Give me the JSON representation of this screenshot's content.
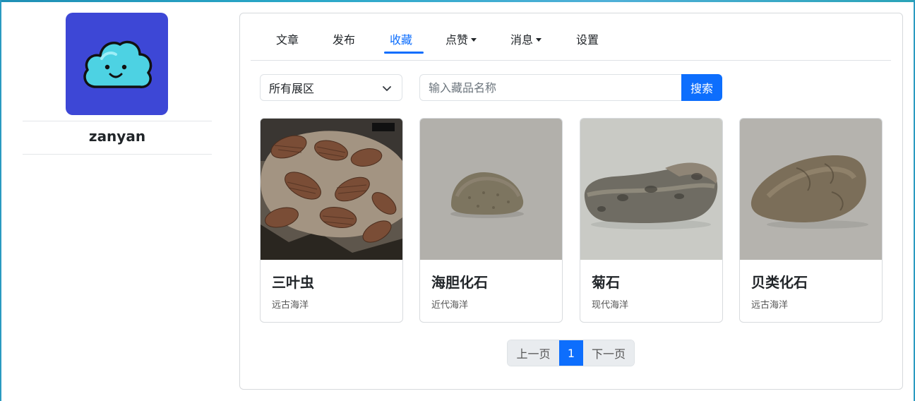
{
  "profile": {
    "username": "zanyan",
    "avatar_icon": "cloud-smile-icon"
  },
  "tabs": [
    {
      "label": "文章"
    },
    {
      "label": "发布"
    },
    {
      "label": "收藏",
      "active": true
    },
    {
      "label": "点赞",
      "dropdown": true
    },
    {
      "label": "消息",
      "dropdown": true
    },
    {
      "label": "设置"
    }
  ],
  "filter": {
    "selected": "所有展区"
  },
  "search": {
    "placeholder": "输入藏品名称",
    "button_label": "搜索"
  },
  "cards": [
    {
      "title": "三叶虫",
      "subtitle": "远古海洋"
    },
    {
      "title": "海胆化石",
      "subtitle": "近代海洋"
    },
    {
      "title": "菊石",
      "subtitle": "现代海洋"
    },
    {
      "title": "贝类化石",
      "subtitle": "远古海洋"
    }
  ],
  "pagination": {
    "prev": "上一页",
    "current": "1",
    "next": "下一页"
  },
  "colors": {
    "accent": "#0d6efd",
    "avatar_bg": "#3d47d6",
    "cloud": "#4dd2e3"
  }
}
